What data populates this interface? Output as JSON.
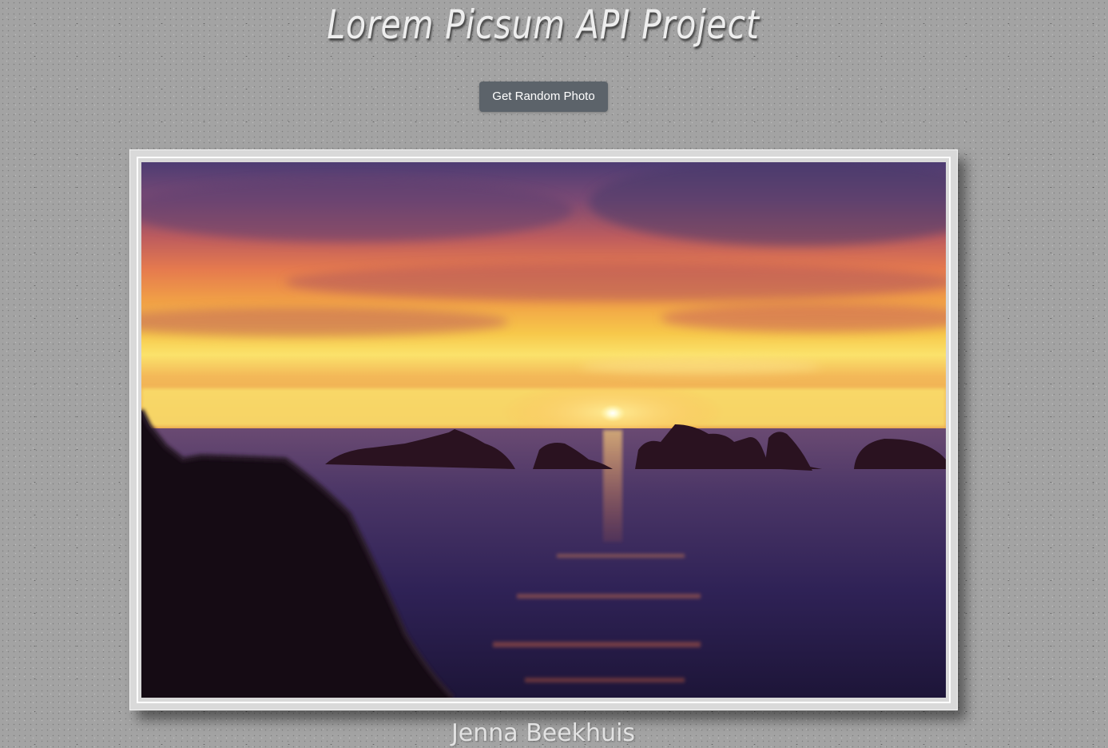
{
  "header": {
    "title": "Lorem Picsum API Project"
  },
  "actions": {
    "random_photo_label": "Get Random Photo"
  },
  "photo": {
    "author": "Jenna Beekhuis"
  },
  "colors": {
    "background": "#a3a3a3",
    "button": "#5c636a",
    "frame": "#d9d9d9"
  }
}
